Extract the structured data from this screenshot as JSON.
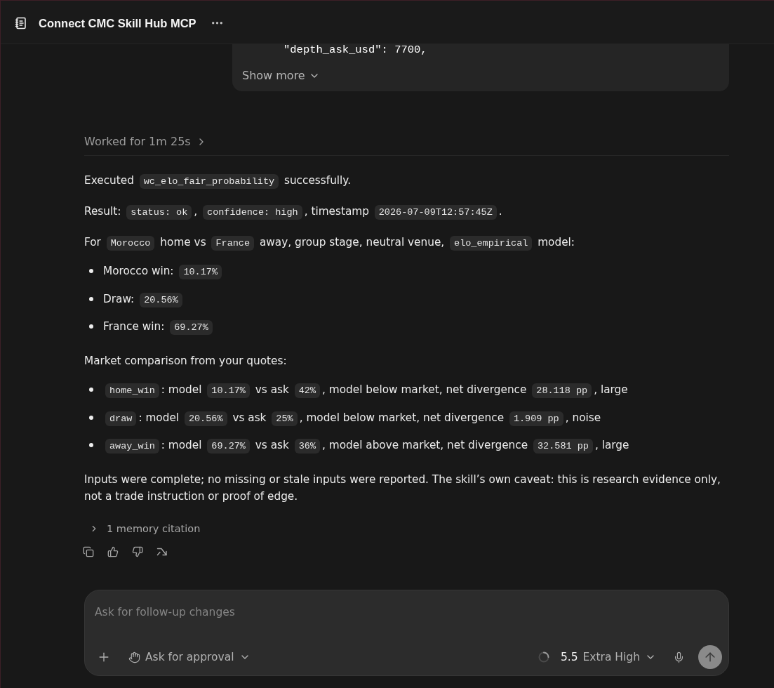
{
  "header": {
    "title": "Connect CMC Skill Hub MCP"
  },
  "tool_output": {
    "code_line": "\"depth_ask_usd\": 7700,",
    "toggle": "Show more"
  },
  "worked": {
    "label": "Worked for 1m 25s"
  },
  "message": [
    {
      "kind": "paragraph",
      "segments": [
        {
          "kind": "text",
          "text": "Executed "
        },
        {
          "kind": "code",
          "text": "wc_elo_fair_probability"
        },
        {
          "kind": "text",
          "text": " successfully."
        }
      ]
    },
    {
      "kind": "paragraph",
      "segments": [
        {
          "kind": "text",
          "text": "Result: "
        },
        {
          "kind": "code",
          "text": "status: ok"
        },
        {
          "kind": "text",
          "text": ", "
        },
        {
          "kind": "code",
          "text": "confidence: high"
        },
        {
          "kind": "text",
          "text": ", timestamp "
        },
        {
          "kind": "code",
          "text": "2026-07-09T12:57:45Z"
        },
        {
          "kind": "text",
          "text": "."
        }
      ]
    },
    {
      "kind": "paragraph",
      "segments": [
        {
          "kind": "text",
          "text": "For "
        },
        {
          "kind": "code",
          "text": "Morocco"
        },
        {
          "kind": "text",
          "text": " home vs "
        },
        {
          "kind": "code",
          "text": "France"
        },
        {
          "kind": "text",
          "text": " away, group stage, neutral venue, "
        },
        {
          "kind": "code",
          "text": "elo_empirical"
        },
        {
          "kind": "text",
          "text": " model:"
        }
      ]
    },
    {
      "kind": "list",
      "items": [
        {
          "segments": [
            {
              "kind": "text",
              "text": "Morocco win: "
            },
            {
              "kind": "code",
              "text": "10.17%"
            }
          ]
        },
        {
          "segments": [
            {
              "kind": "text",
              "text": "Draw: "
            },
            {
              "kind": "code",
              "text": "20.56%"
            }
          ]
        },
        {
          "segments": [
            {
              "kind": "text",
              "text": "France win: "
            },
            {
              "kind": "code",
              "text": "69.27%"
            }
          ]
        }
      ]
    },
    {
      "kind": "paragraph",
      "segments": [
        {
          "kind": "text",
          "text": "Market comparison from your quotes:"
        }
      ]
    },
    {
      "kind": "list",
      "items": [
        {
          "segments": [
            {
              "kind": "code",
              "text": "home_win"
            },
            {
              "kind": "text",
              "text": ": model "
            },
            {
              "kind": "code",
              "text": "10.17%"
            },
            {
              "kind": "text",
              "text": " vs ask "
            },
            {
              "kind": "code",
              "text": "42%"
            },
            {
              "kind": "text",
              "text": ", model below market, net divergence "
            },
            {
              "kind": "code",
              "text": "28.118 pp"
            },
            {
              "kind": "text",
              "text": ", large"
            }
          ]
        },
        {
          "segments": [
            {
              "kind": "code",
              "text": "draw"
            },
            {
              "kind": "text",
              "text": ": model "
            },
            {
              "kind": "code",
              "text": "20.56%"
            },
            {
              "kind": "text",
              "text": " vs ask "
            },
            {
              "kind": "code",
              "text": "25%"
            },
            {
              "kind": "text",
              "text": ", model below market, net divergence "
            },
            {
              "kind": "code",
              "text": "1.909 pp"
            },
            {
              "kind": "text",
              "text": ", noise"
            }
          ]
        },
        {
          "segments": [
            {
              "kind": "code",
              "text": "away_win"
            },
            {
              "kind": "text",
              "text": ": model "
            },
            {
              "kind": "code",
              "text": "69.27%"
            },
            {
              "kind": "text",
              "text": " vs ask "
            },
            {
              "kind": "code",
              "text": "36%"
            },
            {
              "kind": "text",
              "text": ", model above market, net divergence "
            },
            {
              "kind": "code",
              "text": "32.581 pp"
            },
            {
              "kind": "text",
              "text": ", large"
            }
          ]
        }
      ]
    },
    {
      "kind": "paragraph",
      "segments": [
        {
          "kind": "text",
          "text": "Inputs were complete; no missing or stale inputs were reported. The skill’s own caveat: this is research evidence only, not a trade instruction or proof of edge."
        }
      ]
    }
  ],
  "citation": {
    "label": "1 memory citation"
  },
  "composer": {
    "placeholder": "Ask for follow-up changes",
    "approval": "Ask for approval",
    "model_version": "5.5",
    "effort": "Extra High"
  }
}
